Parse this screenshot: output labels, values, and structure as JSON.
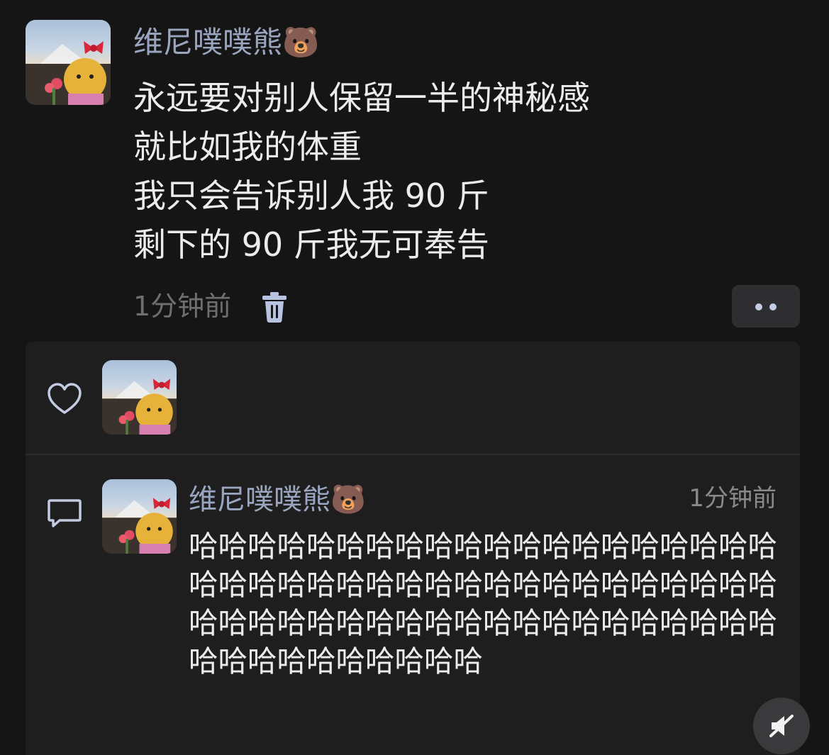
{
  "post": {
    "author": "维尼噗噗熊🐻",
    "lines": [
      "永远要对别人保留一半的神秘感",
      "就比如我的体重",
      "我只会告诉别人我 90 斤",
      "剩下的 90 斤我无可奉告"
    ],
    "time": "1分钟前",
    "icons": {
      "trash": "trash-icon",
      "more": "more-dots-icon"
    }
  },
  "interactions": {
    "like_icon": "heart-icon",
    "comment_icon": "comment-icon"
  },
  "comment": {
    "author": "维尼噗噗熊🐻",
    "time": "1分钟前",
    "text": "哈哈哈哈哈哈哈哈哈哈哈哈哈哈哈哈哈哈哈哈哈哈哈哈哈哈哈哈哈哈哈哈哈哈哈哈哈哈哈哈哈哈哈哈哈哈哈哈哈哈哈哈哈哈哈哈哈哈哈哈哈哈哈哈哈哈哈哈哈哈"
  },
  "colors": {
    "background": "#151515",
    "panel": "#1e1e1f",
    "author_name": "#9aa6bf",
    "body_text": "#ececec",
    "muted_text": "#6e6e73"
  }
}
